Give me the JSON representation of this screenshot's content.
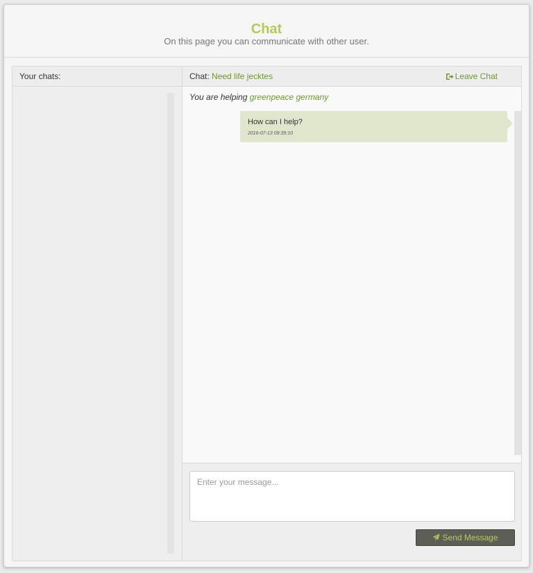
{
  "header": {
    "title": "Chat",
    "subtitle": "On this page you can communicate with other user."
  },
  "left_panel": {
    "heading": "Your chats:"
  },
  "chat": {
    "label": "Chat:",
    "topic": "Need life jecktes",
    "leave_label": "Leave Chat",
    "helping_prefix": "You are helping",
    "helping_name": "greenpeace germany",
    "messages": [
      {
        "text": "How can I help?",
        "time": "2016-07-13 09:39:10"
      }
    ],
    "input_placeholder": "Enter your message...",
    "send_label": "Send Message"
  },
  "colors": {
    "accent": "#b3cc55",
    "link": "#6a9a2a",
    "bubble": "#dfe6cc",
    "button": "#5d5f57"
  },
  "icons": {
    "leave": "sign-out-icon",
    "send": "paper-plane-icon"
  }
}
